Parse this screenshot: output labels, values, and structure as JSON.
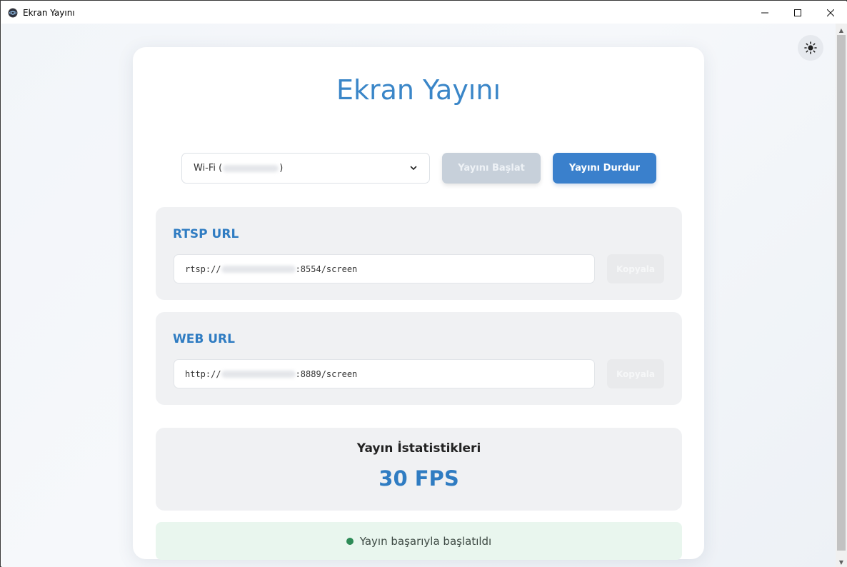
{
  "window": {
    "title": "Ekran Yayını"
  },
  "header": {
    "title": "Ekran Yayını"
  },
  "network": {
    "selected_prefix": "Wi-Fi (",
    "selected_suffix": ")"
  },
  "buttons": {
    "start_label": "Yayını Başlat",
    "stop_label": "Yayını Durdur"
  },
  "rtsp": {
    "title": "RTSP URL",
    "url_prefix": "rtsp://",
    "url_suffix": ":8554/screen",
    "copy_label": "Kopyala"
  },
  "web": {
    "title": "WEB URL",
    "url_prefix": "http://",
    "url_suffix": ":8889/screen",
    "copy_label": "Kopyala"
  },
  "stats": {
    "title": "Yayın İstatistikleri",
    "fps": "30 FPS"
  },
  "status": {
    "message": "Yayın başarıyla başlatıldı",
    "color": "#2e8b57"
  },
  "colors": {
    "accent": "#3a80cc",
    "title_blue": "#3a86c8",
    "disabled": "#c7d0da"
  }
}
